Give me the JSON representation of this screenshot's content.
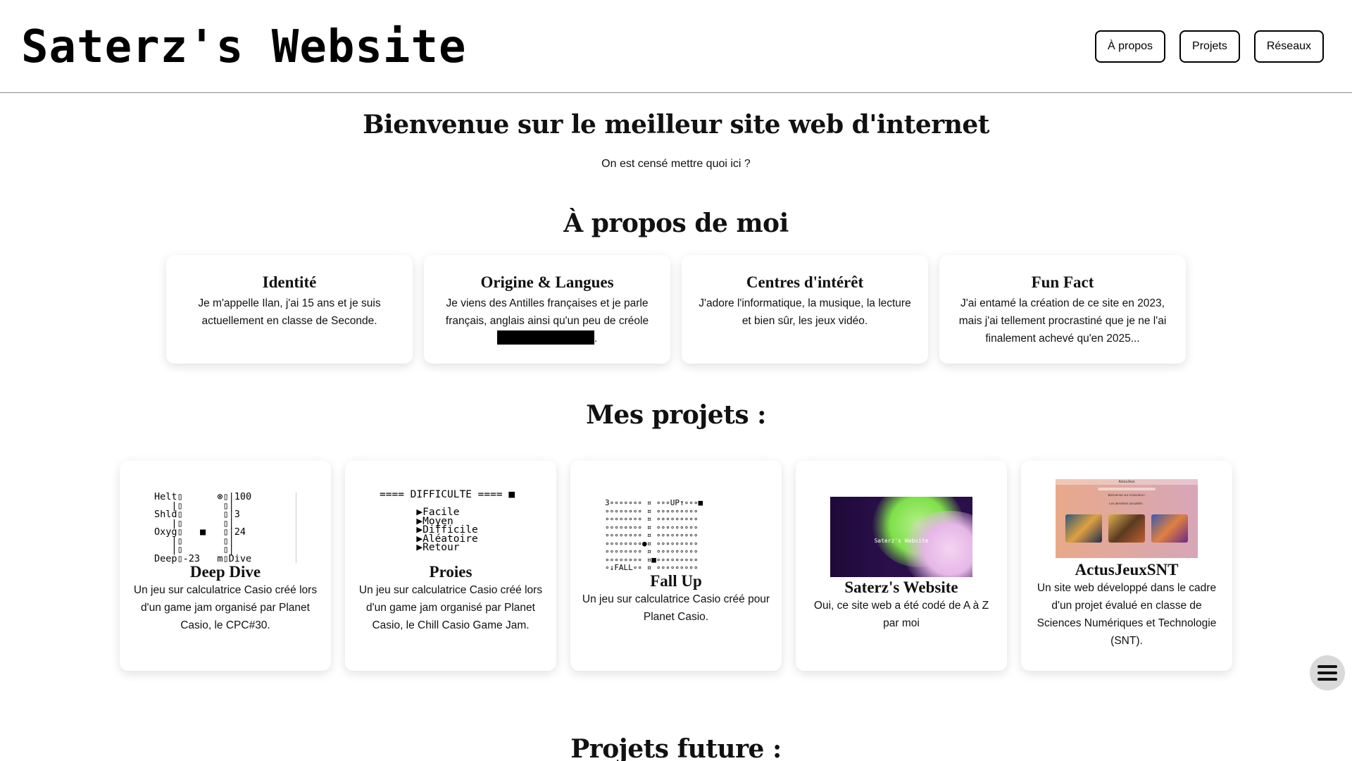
{
  "header": {
    "title": "Saterz's Website",
    "nav": [
      "À propos",
      "Projets",
      "Réseaux"
    ]
  },
  "hero": {
    "title": "Bienvenue sur le meilleur site web d'internet",
    "subtitle": "On est censé mettre quoi ici ?"
  },
  "about": {
    "title": "À propos de moi",
    "cards": [
      {
        "title": "Identité",
        "text": "Je m'appelle Ilan, j'ai 15 ans et je suis actuellement en classe de Seconde."
      },
      {
        "title": "Origine & Langues",
        "text": "Je viens des Antilles françaises et je parle français, anglais ainsi qu'un peu de créole",
        "suffix": "."
      },
      {
        "title": "Centres d'intérêt",
        "text": "J'adore l'informatique, la musique, la lecture et bien sûr, les jeux vidéo."
      },
      {
        "title": "Fun Fact",
        "text": "J'ai entamé la création de ce site en 2023, mais j'ai tellement procrastiné que je ne l'ai finalement achevé qu'en 2025..."
      }
    ]
  },
  "projects": {
    "title": "Mes projets :",
    "items": [
      {
        "title": "Deep Dive",
        "text": "Un jeu sur calculatrice Casio créé lors d'un game jam organisé par Planet Casio, le CPC#30."
      },
      {
        "title": "Proies",
        "text": "Un jeu sur calculatrice Casio créé lors d'un game jam organisé par Planet Casio, le Chill Casio Game Jam."
      },
      {
        "title": "Fall Up",
        "text": "Un jeu sur calculatrice Casio créé pour Planet Casio."
      },
      {
        "title": "Saterz's Website",
        "text": "Oui, ce site web a été codé de A à Z par moi"
      },
      {
        "title": "ActusJeuxSNT",
        "text": "Un site web développé dans le cadre d'un projet évalué en classe de Sciences Numériques et Technologie (SNT)."
      }
    ],
    "screens": {
      "deepdive": "Helt▯      ⊗▯|100\n   |▯       ▯|\nShld▯       ▯|3\n   |▯       ▯|\nOxyg▯   ■   ▯|24\n   |▯       ▯|\n   |▯       ▯|\nDeep▯-23   m▯Dive",
      "proies": "==== DIFFICULTE ==== ■\n\n      ▶Facile\n      ▶Moyen\n      ▶Difficile\n      ▶Aléatoire\n      ▶Retour",
      "fallup": "3∘∘∘∘∘∘∘ ¤ ∘∘∘UP↑∘∘∘■\n∘∘∘∘∘∘∘∘ ¤ ∘∘∘∘∘∘∘∘∘\n∘∘∘∘∘∘∘∘ ¤ ∘∘∘∘∘∘∘∘∘\n∘∘∘∘∘∘∘∘ ¤ ∘∘∘∘∘∘∘∘∘\n∘∘∘∘∘∘∘∘ ¤ ∘∘∘∘∘∘∘∘∘\n∘∘∘∘∘∘∘∘●¤ ∘∘∘∘∘∘∘∘∘\n∘∘∘∘∘∘∘∘ ¤ ∘∘∘∘∘∘∘∘∘\n∘∘∘∘∘∘∘∘ ¤■∘∘∘∘∘∘∘∘∘\n∘↓FALL∘∘ ¤ ∘∘∘∘∘∘∘∘∘",
      "website_banner": "Saterz's Website",
      "actus_header": "ActusJeux",
      "actus_subtitle": "Bienvenue sur ActusJeux !",
      "actus_section": "Les dernières actualités :"
    }
  },
  "future": {
    "title": "Projets future :"
  },
  "colors": {
    "accent_green": "#7ee04a",
    "accent_purple": "#2a0f4a",
    "actus_bg": "#e8a98a"
  },
  "icons": {
    "menu": "hamburger-menu-icon"
  }
}
